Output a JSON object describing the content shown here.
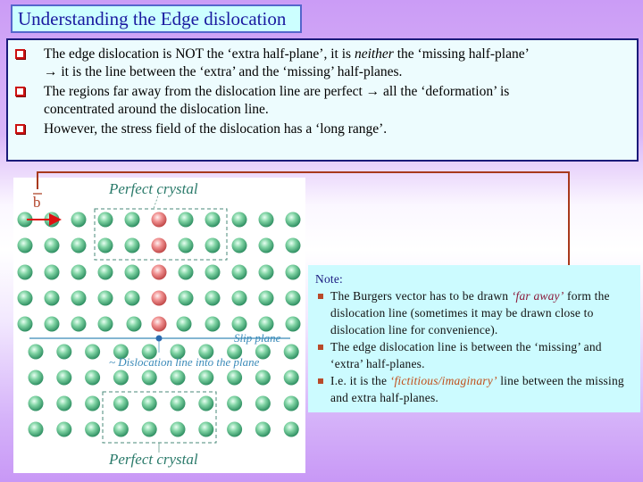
{
  "title": "Understanding the Edge dislocation",
  "bullets": [
    {
      "parts": [
        {
          "text": "The edge dislocation is NOT the ‘extra half-plane’, it is ",
          "style": "normal"
        },
        {
          "text": "neither",
          "style": "italic"
        },
        {
          "text": " the ‘missing half-plane’",
          "style": "normal"
        }
      ],
      "continuation": "→ it is the line between the ‘extra’ and the ‘missing’ half-planes."
    },
    {
      "parts": [
        {
          "text": "The regions far away from the dislocation line are perfect → all the ‘deformation’ is",
          "style": "normal"
        }
      ],
      "continuation": "concentrated around the dislocation line."
    },
    {
      "parts": [
        {
          "text": "However, the stress field of the dislocation has a ‘long range’.",
          "style": "normal"
        }
      ],
      "continuation": ""
    }
  ],
  "diagram": {
    "top_label": "Perfect crystal",
    "bottom_label": "Perfect crystal",
    "burgers_label": "b",
    "slip_plane_label": "Slip plane",
    "dislocation_label": "~ Dislocation line into the plane",
    "upper_rows": 5,
    "upper_atoms_per_row": 11,
    "extra_half_plane_column": 6,
    "lower_rows": 4,
    "lower_atoms_per_row": 10,
    "colors": {
      "atom": "#5cc08a",
      "extra_atom": "#e86a6a",
      "slip_plane": "#3a8ab8",
      "label": "#2a7a6a",
      "burgers_arrow": "#dd1111"
    }
  },
  "note": {
    "title": "Note:",
    "items": [
      {
        "parts": [
          {
            "text": "The Burgers vector has to be drawn ",
            "style": "normal"
          },
          {
            "text": "‘far away’",
            "style": "hl1"
          },
          {
            "text": " form the dislocation line (sometimes it may be drawn close to dislocation line for convenience).",
            "style": "normal"
          }
        ]
      },
      {
        "parts": [
          {
            "text": "The edge dislocation line is between the ‘missing’ and ‘extra’ half-planes.",
            "style": "normal"
          }
        ]
      },
      {
        "parts": [
          {
            "text": "I.e. it is the ",
            "style": "normal"
          },
          {
            "text": "‘fictitious/imaginary’",
            "style": "hl2"
          },
          {
            "text": " line between the missing and extra half-planes.",
            "style": "normal"
          }
        ]
      }
    ]
  },
  "colors": {
    "title_text": "#1a1aa0",
    "title_bg": "#ccffff",
    "bullet_box_bg": "#edfcfe",
    "note_bg": "#ccfbff",
    "connector": "#a8391c",
    "background_purple": "#cb9cf6"
  }
}
